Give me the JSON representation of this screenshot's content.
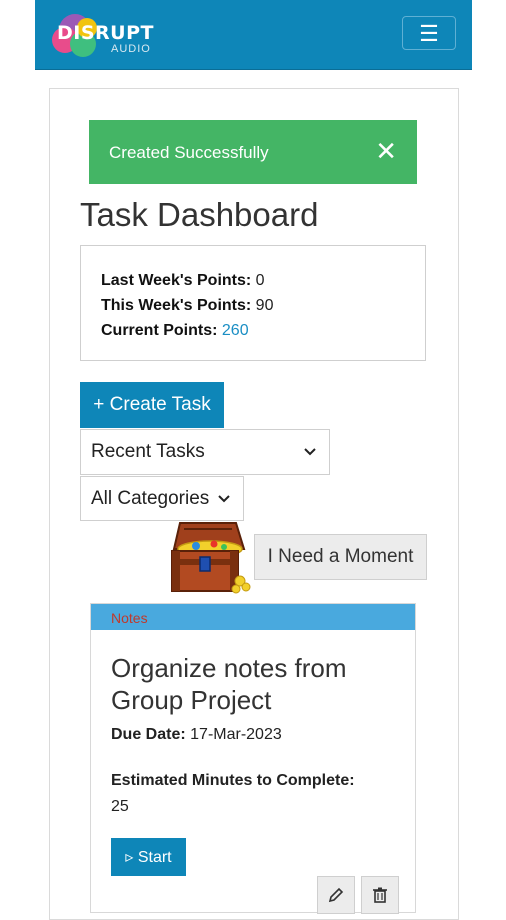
{
  "header": {
    "logo_text": "DISRUPT",
    "logo_subtext": "AUDIO",
    "menu_icon": "hamburger-menu-icon"
  },
  "alert": {
    "message": "Created Successfully",
    "close_icon": "close-icon",
    "color": "#44b565"
  },
  "page": {
    "title": "Task Dashboard"
  },
  "points": {
    "last_week_label": "Last Week's Points:",
    "last_week_value": "0",
    "this_week_label": "This Week's Points:",
    "this_week_value": "90",
    "current_label": "Current Points:",
    "current_value": "260"
  },
  "actions": {
    "create_task_label": "+ Create Task",
    "filter_time_selected": "Recent Tasks",
    "filter_category_selected": "All Categories",
    "moment_button_label": "I Need a Moment",
    "treasure_icon": "treasure-chest-icon"
  },
  "task": {
    "category": "Notes",
    "title": "Organize notes from Group Project",
    "due_label": "Due Date:",
    "due_value": "17-Mar-2023",
    "estimate_label": "Estimated Minutes to Complete:",
    "estimate_value": "25",
    "start_label": "▹ Start",
    "edit_icon": "pencil-icon",
    "delete_icon": "trash-icon"
  },
  "colors": {
    "brand": "#0e86b8",
    "category_bar": "#49a9de",
    "category_text": "#c0392b"
  }
}
